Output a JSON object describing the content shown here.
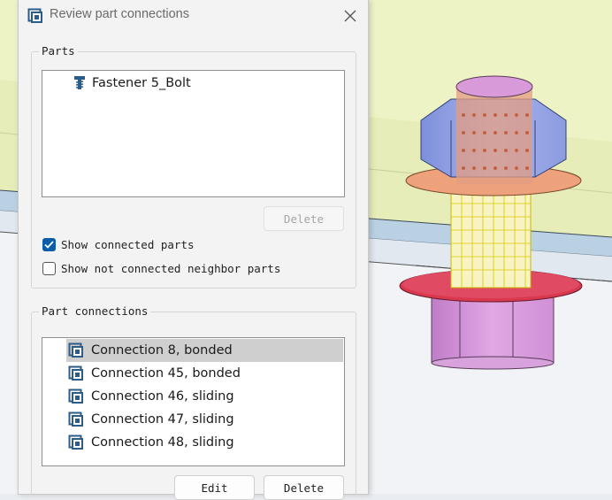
{
  "dialog": {
    "title": "Review part connections",
    "title_icon": "part-connections-icon",
    "close_icon": "close-icon"
  },
  "parts_group": {
    "label": "Parts",
    "items": [
      {
        "label": "Fastener 5_Bolt",
        "icon": "bolt-icon"
      }
    ],
    "delete_label": "Delete",
    "show_connected": {
      "label": "Show connected parts",
      "checked": true
    },
    "show_not_connected": {
      "label": "Show not connected neighbor parts",
      "checked": false
    }
  },
  "connections_group": {
    "label": "Part connections",
    "items": [
      {
        "label": "Connection 8, bonded",
        "icon": "connection-icon",
        "selected": true
      },
      {
        "label": "Connection 45, bonded",
        "icon": "connection-icon",
        "selected": false
      },
      {
        "label": "Connection 46, sliding",
        "icon": "connection-icon",
        "selected": false
      },
      {
        "label": "Connection 47, sliding",
        "icon": "connection-icon",
        "selected": false
      },
      {
        "label": "Connection 48, sliding",
        "icon": "connection-icon",
        "selected": false
      }
    ],
    "edit_label": "Edit",
    "delete_label": "Delete"
  },
  "colors": {
    "accent": "#0b5cab",
    "selection": "#cfcfcf",
    "connection_icon": "#2b5d8a",
    "bolt_head": "#8e9ee0",
    "washer_top": "#f0a67c",
    "washer_bottom": "#d93a52",
    "nut": "#d39ad8",
    "plate": "#eef3c8"
  }
}
